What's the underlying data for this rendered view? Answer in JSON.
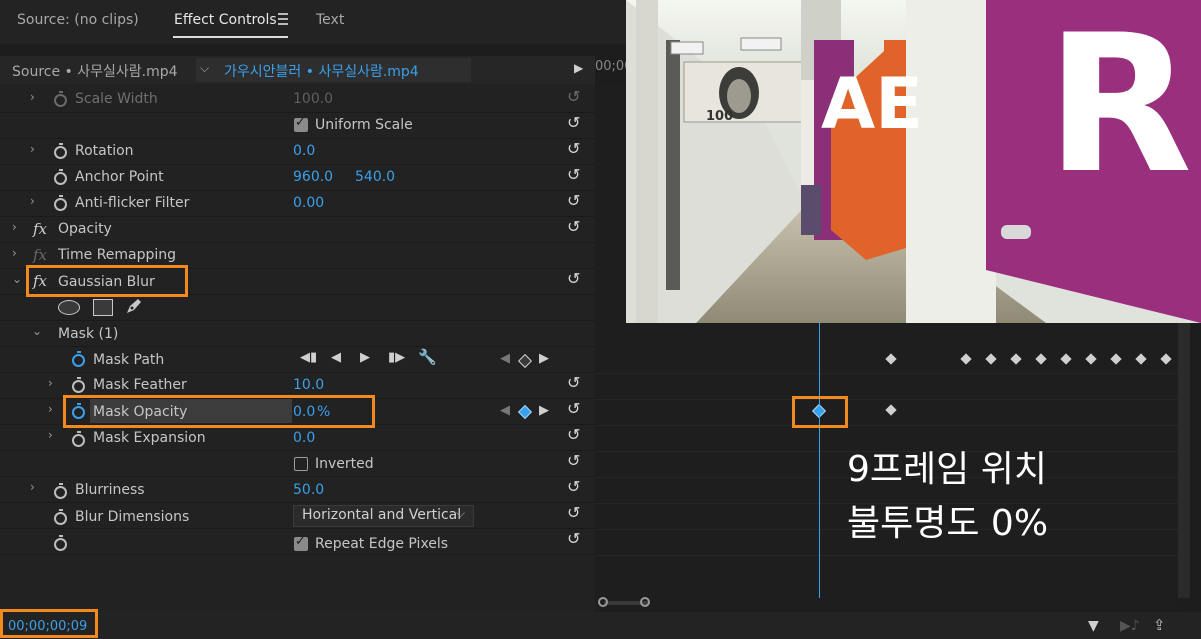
{
  "tabs": {
    "source": "Source: (no clips)",
    "effect_controls": "Effect Controls",
    "text": "Text"
  },
  "source_row": {
    "master": "Source • 사무실사람.mp4",
    "clip": "가우시안블러 • 사무실사람.mp4",
    "timeline_time": "00;00"
  },
  "rows": {
    "scale_width": {
      "label": "Scale Width",
      "value": "100.0"
    },
    "uniform_scale": {
      "label": "Uniform Scale"
    },
    "rotation": {
      "label": "Rotation",
      "value": "0.0"
    },
    "anchor_point": {
      "label": "Anchor Point",
      "x": "960.0",
      "y": "540.0"
    },
    "anti_flicker": {
      "label": "Anti-flicker Filter",
      "value": "0.00"
    },
    "opacity": {
      "label": "Opacity"
    },
    "time_remapping": {
      "label": "Time Remapping"
    },
    "gaussian_blur": {
      "label": "Gaussian Blur"
    },
    "mask": {
      "label": "Mask (1)"
    },
    "mask_path": {
      "label": "Mask Path"
    },
    "mask_feather": {
      "label": "Mask Feather",
      "value": "10.0"
    },
    "mask_opacity": {
      "label": "Mask Opacity",
      "value": "0.0",
      "unit": "%"
    },
    "mask_expansion": {
      "label": "Mask Expansion",
      "value": "0.0"
    },
    "inverted": {
      "label": "Inverted"
    },
    "blurriness": {
      "label": "Blurriness",
      "value": "50.0"
    },
    "blur_dimensions": {
      "label": "Blur Dimensions",
      "value": "Horizontal and Vertical"
    },
    "repeat_edge": {
      "label": "Repeat Edge Pixels"
    }
  },
  "overlay": {
    "line1": "9프레임 위치",
    "line2": "불투명도 0%"
  },
  "preview": {
    "sign_ae": "AE",
    "sign_r": "R",
    "banknote": "100"
  },
  "timecode": "00;00;00;09",
  "colors": {
    "accent_blue": "#3aa0ea",
    "highlight_orange": "#f28a1f",
    "wall_purple": "#9a2f7e",
    "door_orange": "#e0642a"
  },
  "icons": [
    "menu-icon",
    "stopwatch-icon",
    "reset-icon",
    "fx-icon",
    "ellipse-mask-icon",
    "rectangle-mask-icon",
    "pen-mask-icon",
    "keyframe-icon",
    "filter-icon",
    "export-icon"
  ]
}
